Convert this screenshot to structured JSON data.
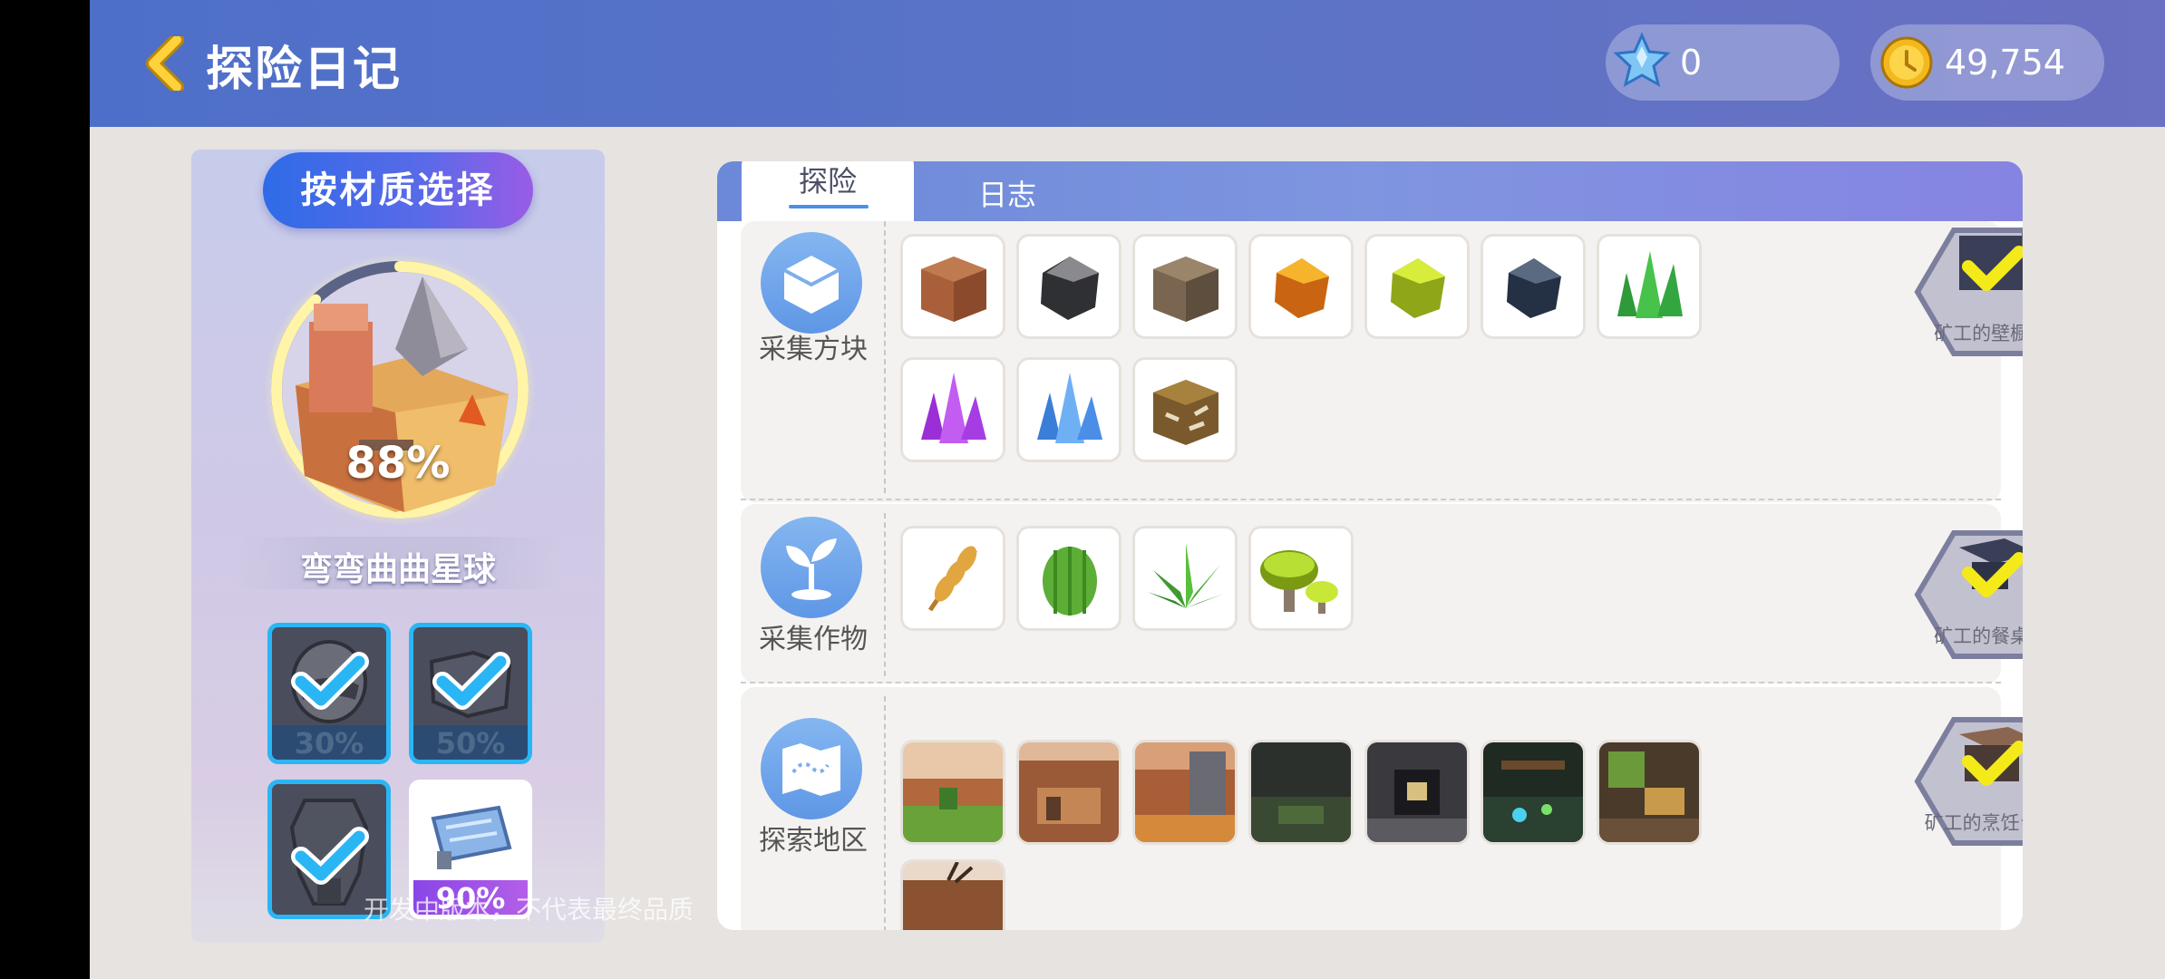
{
  "header": {
    "title": "探险日记",
    "gems": "0",
    "coins": "49,754"
  },
  "left": {
    "material_button": "按材质选择",
    "planet_percent": "88%",
    "planet_progress": 0.88,
    "planet_name": "弯弯曲曲星球",
    "materials": [
      {
        "name": "helmet",
        "percent": "30%",
        "checked": true
      },
      {
        "name": "boots",
        "percent": "50%",
        "checked": true
      },
      {
        "name": "armor",
        "percent": "",
        "checked": true
      },
      {
        "name": "blueprint",
        "percent": "90%",
        "checked": false
      }
    ],
    "watermark": "开发中版本，不代表最终品质"
  },
  "tabs": {
    "active": "探险",
    "other": "日志"
  },
  "sections": [
    {
      "label": "采集方块",
      "icon": "cube-icon",
      "reward": "矿工的壁橱 配方",
      "items": [
        "dirt-block",
        "coal-ore",
        "stone-block",
        "amber-gem",
        "sulfur-gem",
        "dark-gem",
        "green-crystal",
        "purple-crystal",
        "blue-crystal",
        "fossil-block"
      ]
    },
    {
      "label": "采集作物",
      "icon": "sprout-icon",
      "reward": "矿工的餐桌 配方",
      "items": [
        "wheat",
        "cactus",
        "aloe",
        "glow-mushroom"
      ]
    },
    {
      "label": "探索地区",
      "icon": "map-icon",
      "reward": "矿工的烹饪台 配方",
      "items": [
        "region-1",
        "region-2",
        "region-3",
        "region-4",
        "region-5",
        "region-6",
        "region-7",
        "region-8"
      ]
    }
  ],
  "colors": {
    "accent": "#2ab6f4",
    "check": "#f4ea1a",
    "header": "#5a74c7"
  }
}
